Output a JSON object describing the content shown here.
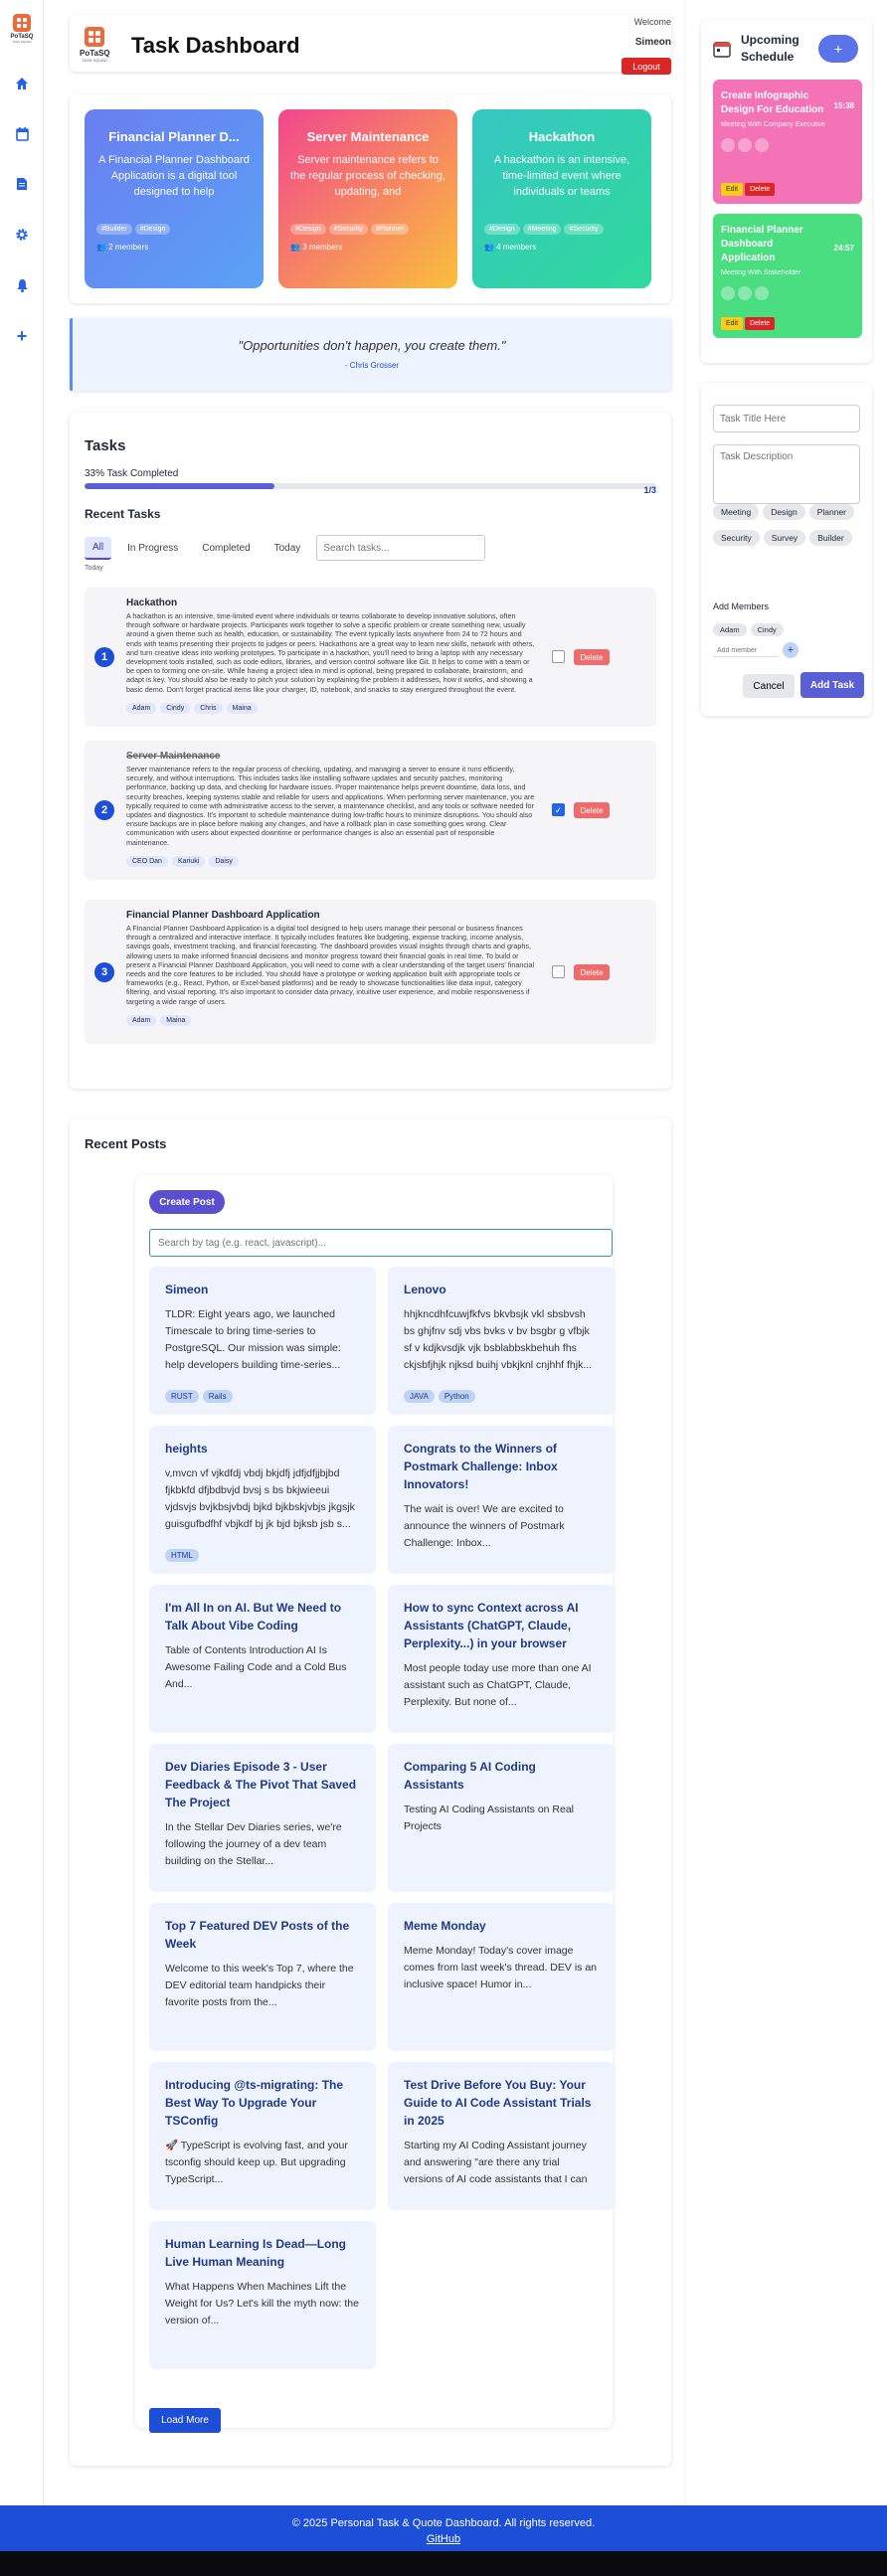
{
  "app": {
    "logo_text": "PoTaSQ",
    "logo_sub": "TASK SQUAD",
    "title": "Task Dashboard",
    "welcome": "Welcome",
    "username": "Simeon",
    "logout": "Logout"
  },
  "nav": [
    "home-icon",
    "calendar-icon",
    "document-icon",
    "gear-icon",
    "bell-icon",
    "plus-icon"
  ],
  "projects": [
    {
      "title": "Financial Planner D...",
      "desc": "A Financial Planner Dashboard Application is a digital tool designed to help",
      "tags": [
        "#Builder",
        "#Design"
      ],
      "members": "2 members",
      "colors": [
        "#6a7ef0",
        "#5aa2f5"
      ]
    },
    {
      "title": "Server Maintenance",
      "desc": "Server maintenance refers to the regular process of checking, updating, and",
      "tags": [
        "#Design",
        "#Security",
        "#Planner"
      ],
      "members": "3 members",
      "colors": [
        "#f2468e",
        "#fbbf3b"
      ]
    },
    {
      "title": "Hackathon",
      "desc": "A hackathon is an intensive, time-limited event where individuals or teams",
      "tags": [
        "#Design",
        "#Meeting",
        "#Security"
      ],
      "members": "4 members",
      "colors": [
        "#36c7c3",
        "#2fd99a"
      ]
    }
  ],
  "quote": {
    "text": "\"Opportunities don't happen, you create them.\"",
    "author": "- Chris Grosser"
  },
  "tasks": {
    "heading": "Tasks",
    "progress_text": "33% Task Completed",
    "count": "1/3",
    "progress": 0.333,
    "recent": "Recent Tasks",
    "tabs": [
      "All",
      "In Progress",
      "Completed",
      "Today"
    ],
    "search_placeholder": "Search tasks...",
    "today": "Today",
    "items": [
      {
        "num": "1",
        "name": "Hackathon",
        "done": false,
        "desc": "A hackathon is an intensive, time-limited event where individuals or teams collaborate to develop innovative solutions, often through software or hardware projects. Participants work together to solve a specific problem or create something new, usually around a given theme such as health, education, or sustainability. The event typically lasts anywhere from 24 to 72 hours and ends with teams presenting their projects to judges or peers. Hackathons are a great way to learn new skills, network with others, and turn creative ideas into working prototypes. To participate in a hackathon, you'll need to bring a laptop with any necessary development tools installed, such as code editors, libraries, and version control software like Git. It helps to come with a team or be open to forming one on-site. While having a project idea in mind is optional, being prepared to collaborate, brainstorm, and adapt is key. You should also be ready to pitch your solution by explaining the problem it addresses, how it works, and showing a basic demo. Don't forget practical items like your charger, ID, notebook, and snacks to stay energized throughout the event.",
        "members": [
          "Adam",
          "Cindy",
          "Chris",
          "Maina"
        ],
        "delete": "Delete"
      },
      {
        "num": "2",
        "name": "Server Maintenance",
        "done": true,
        "desc": "Server maintenance refers to the regular process of checking, updating, and managing a server to ensure it runs efficiently, securely, and without interruptions. This includes tasks like installing software updates and security patches, monitoring performance, backing up data, and checking for hardware issues. Proper maintenance helps prevent downtime, data loss, and security breaches, keeping systems stable and reliable for users and applications. When performing server maintenance, you are typically required to come with administrative access to the server, a maintenance checklist, and any tools or software needed for updates and diagnostics. It's important to schedule maintenance during low-traffic hours to minimize disruptions. You should also ensure backups are in place before making any changes, and have a rollback plan in case something goes wrong. Clear communication with users about expected downtime or performance changes is also an essential part of responsible maintenance.",
        "members": [
          "CEO Dan",
          "Kariuki",
          "Daisy"
        ],
        "delete": "Delete"
      },
      {
        "num": "3",
        "name": "Financial Planner Dashboard Application",
        "done": false,
        "desc": "A Financial Planner Dashboard Application is a digital tool designed to help users manage their personal or business finances through a centralized and interactive interface. It typically includes features like budgeting, expense tracking, income analysis, savings goals, investment tracking, and financial forecasting. The dashboard provides visual insights through charts and graphs, allowing users to make informed financial decisions and monitor progress toward their financial goals in real time. To build or present a Financial Planner Dashboard Application, you will need to come with a clear understanding of the target users' financial needs and the core features to be included. You should have a prototype or working application built with appropriate tools or frameworks (e.g., React, Python, or Excel-based platforms) and be ready to showcase functionalities like data input, category filtering, and visual reporting. It's also important to consider data privacy, intuitive user experience, and mobile responsiveness if targeting a wide range of users.",
        "members": [
          "Adam",
          "Maina"
        ],
        "delete": "Delete"
      }
    ]
  },
  "posts": {
    "heading": "Recent Posts",
    "create": "Create Post",
    "search_placeholder": "Search by tag (e.g. react, javascript)...",
    "load_more": "Load More",
    "items": [
      {
        "title": "Simeon",
        "excerpt": "TLDR: Eight years ago, we launched Timescale to bring time-series to PostgreSQL. Our mission was simple: help developers building time-series...",
        "tags": [
          "RUST",
          "Rails"
        ]
      },
      {
        "title": "Lenovo",
        "excerpt": "hhjkncdhfcuwjfkfvs bkvbsjk vkl sbsbvsh bs ghjfnv sdj vbs bvks v bv bsgbr g vfbjk sf v kdjkvsdjk vjk bsblabbskbehuh fhs ckjsbfjhjk njksd buihj vbkjknl cnjhhf fhjk...",
        "tags": [
          "JAVA",
          "Python"
        ]
      },
      {
        "title": "heights",
        "excerpt": "v,mvcn vf vjkdfdj vbdj bkjdfj jdfjdfjjbjbd fjkbkfd dfjbdbvjd bvsj s bs bkjwieeui vjdsvjs bvjkbsjvbdj bjkd bjkbskjvbjs jkgsjk guisgufbdfhf vbjkdf bj jk bjd bjksb jsb s...",
        "tags": [
          "HTML"
        ]
      },
      {
        "title": "Congrats to the Winners of Postmark Challenge: Inbox Innovators!",
        "excerpt": "The wait is over! We are excited to announce the winners of Postmark Challenge: Inbox...",
        "tags": []
      },
      {
        "title": "I'm All In on AI. But We Need to Talk About Vibe Coding",
        "excerpt": "Table of Contents Introduction AI Is Awesome Failing Code and a Cold Bus And...",
        "tags": []
      },
      {
        "title": "How to sync Context across AI Assistants (ChatGPT, Claude, Perplexity...) in your browser",
        "excerpt": "Most people today use more than one AI assistant such as ChatGPT, Claude, Perplexity. But none of...",
        "tags": []
      },
      {
        "title": "Dev Diaries Episode 3 - User Feedback & The Pivot That Saved The Project",
        "excerpt": "In the Stellar Dev Diaries series, we're following the journey of a dev team building on the Stellar...",
        "tags": []
      },
      {
        "title": "Comparing 5 AI Coding Assistants",
        "excerpt": "Testing AI Coding Assistants on Real Projects",
        "tags": []
      },
      {
        "title": "Top 7 Featured DEV Posts of the Week",
        "excerpt": "Welcome to this week's Top 7, where the DEV editorial team handpicks their favorite posts from the...",
        "tags": []
      },
      {
        "title": "Meme Monday",
        "excerpt": "Meme Monday! Today's cover image comes from last week's thread. DEV is an inclusive space! Humor in...",
        "tags": []
      },
      {
        "title": "Introducing @ts-migrating: The Best Way To Upgrade Your TSConfig",
        "excerpt": "🚀 TypeScript is evolving fast, and your tsconfig should keep up. But upgrading TypeScript...",
        "tags": []
      },
      {
        "title": "Test Drive Before You Buy: Your Guide to AI Code Assistant Trials in 2025",
        "excerpt": "Starting my AI Coding Assistant journey and answering \"are there any trial versions of AI code assistants that I can",
        "tags": []
      },
      {
        "title": "Human Learning Is Dead—Long Live Human Meaning",
        "excerpt": "What Happens When Machines Lift the Weight for Us? Let's kill the myth now: the version of...",
        "tags": []
      }
    ]
  },
  "schedule": {
    "title": "Upcoming Schedule",
    "add": "+",
    "events": [
      {
        "title": "Create Infographic Design For Education",
        "time": "15:38",
        "sub": "Meeting With Company Executive",
        "edit": "Edit",
        "delete": "Delete",
        "color": "#f472b6"
      },
      {
        "title": "Financial Planner Dashboard Application",
        "time": "24:57",
        "sub": "Meeting With Stakeholder",
        "edit": "Edit",
        "delete": "Delete",
        "color": "#4ade80"
      }
    ]
  },
  "form": {
    "title_placeholder": "Task Title Here",
    "desc_placeholder": "Task Description",
    "categories": [
      "Meeting",
      "Design",
      "Planner",
      "Security",
      "Survey",
      "Builder"
    ],
    "add_members": "Add Members",
    "members": [
      "Adam",
      "Cindy"
    ],
    "member_placeholder": "Add member",
    "add_member_btn": "+",
    "cancel": "Cancel",
    "add_task": "Add Task"
  },
  "footer": {
    "copy": "© 2025 Personal Task & Quote Dashboard. All rights reserved.",
    "link": "GitHub"
  }
}
